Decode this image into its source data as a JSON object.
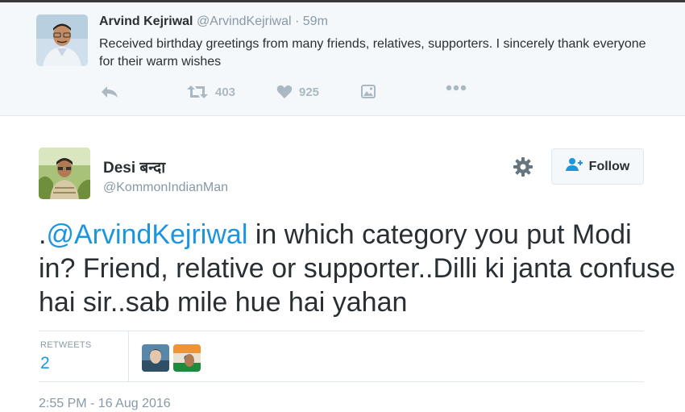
{
  "parent_tweet": {
    "name": "Arvind Kejriwal",
    "handle": "@ArvindKejriwal",
    "separator": "·",
    "time": "59m",
    "text": "Received birthday greetings from many friends, relatives, supporters. I sincerely thank everyone for their warm wishes",
    "actions": {
      "reply_icon": "reply-icon",
      "retweet_icon": "retweet-icon",
      "retweet_count": "403",
      "like_icon": "heart-icon",
      "like_count": "925",
      "photo_icon": "image-icon",
      "more_icon": "more-dots-icon"
    }
  },
  "main_tweet": {
    "name": "Desi बन्दा",
    "handle": "@KommonIndianMan",
    "follow_label": "Follow",
    "settings_icon": "gear-icon",
    "text_prefix": ".",
    "mention": "@ArvindKejriwal",
    "text_rest": " in which category you put Modi in? Friend, relative or supporter..Dilli ki janta confuse hai sir..sab mile hue hai yahan",
    "retweets_label": "RETWEETS",
    "retweets_count": "2",
    "timestamp": "2:55 PM - 16 Aug 2016"
  },
  "colors": {
    "link": "#1b95e0",
    "muted": "#8899a6",
    "text": "#292f33",
    "parent_bg": "#f5f8fa",
    "border": "#e1e8ed"
  }
}
